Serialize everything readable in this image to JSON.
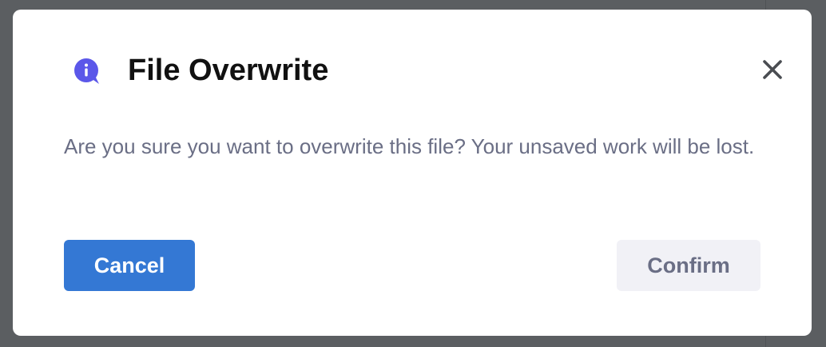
{
  "dialog": {
    "icon": "info-icon",
    "title": "File Overwrite",
    "close_icon": "close-icon",
    "message": "Are you sure you want to overwrite this file? Your unsaved work will be lost.",
    "cancel_label": "Cancel",
    "confirm_label": "Confirm"
  },
  "colors": {
    "backdrop": "#5b5e61",
    "dialog_background": "#ffffff",
    "icon_accent": "#5b57e9",
    "title_text": "#111111",
    "message_text": "#6a6e85",
    "cancel_background": "#3478d4",
    "cancel_text": "#ffffff",
    "confirm_background": "#f1f1f6",
    "confirm_text": "#6a6e85"
  }
}
